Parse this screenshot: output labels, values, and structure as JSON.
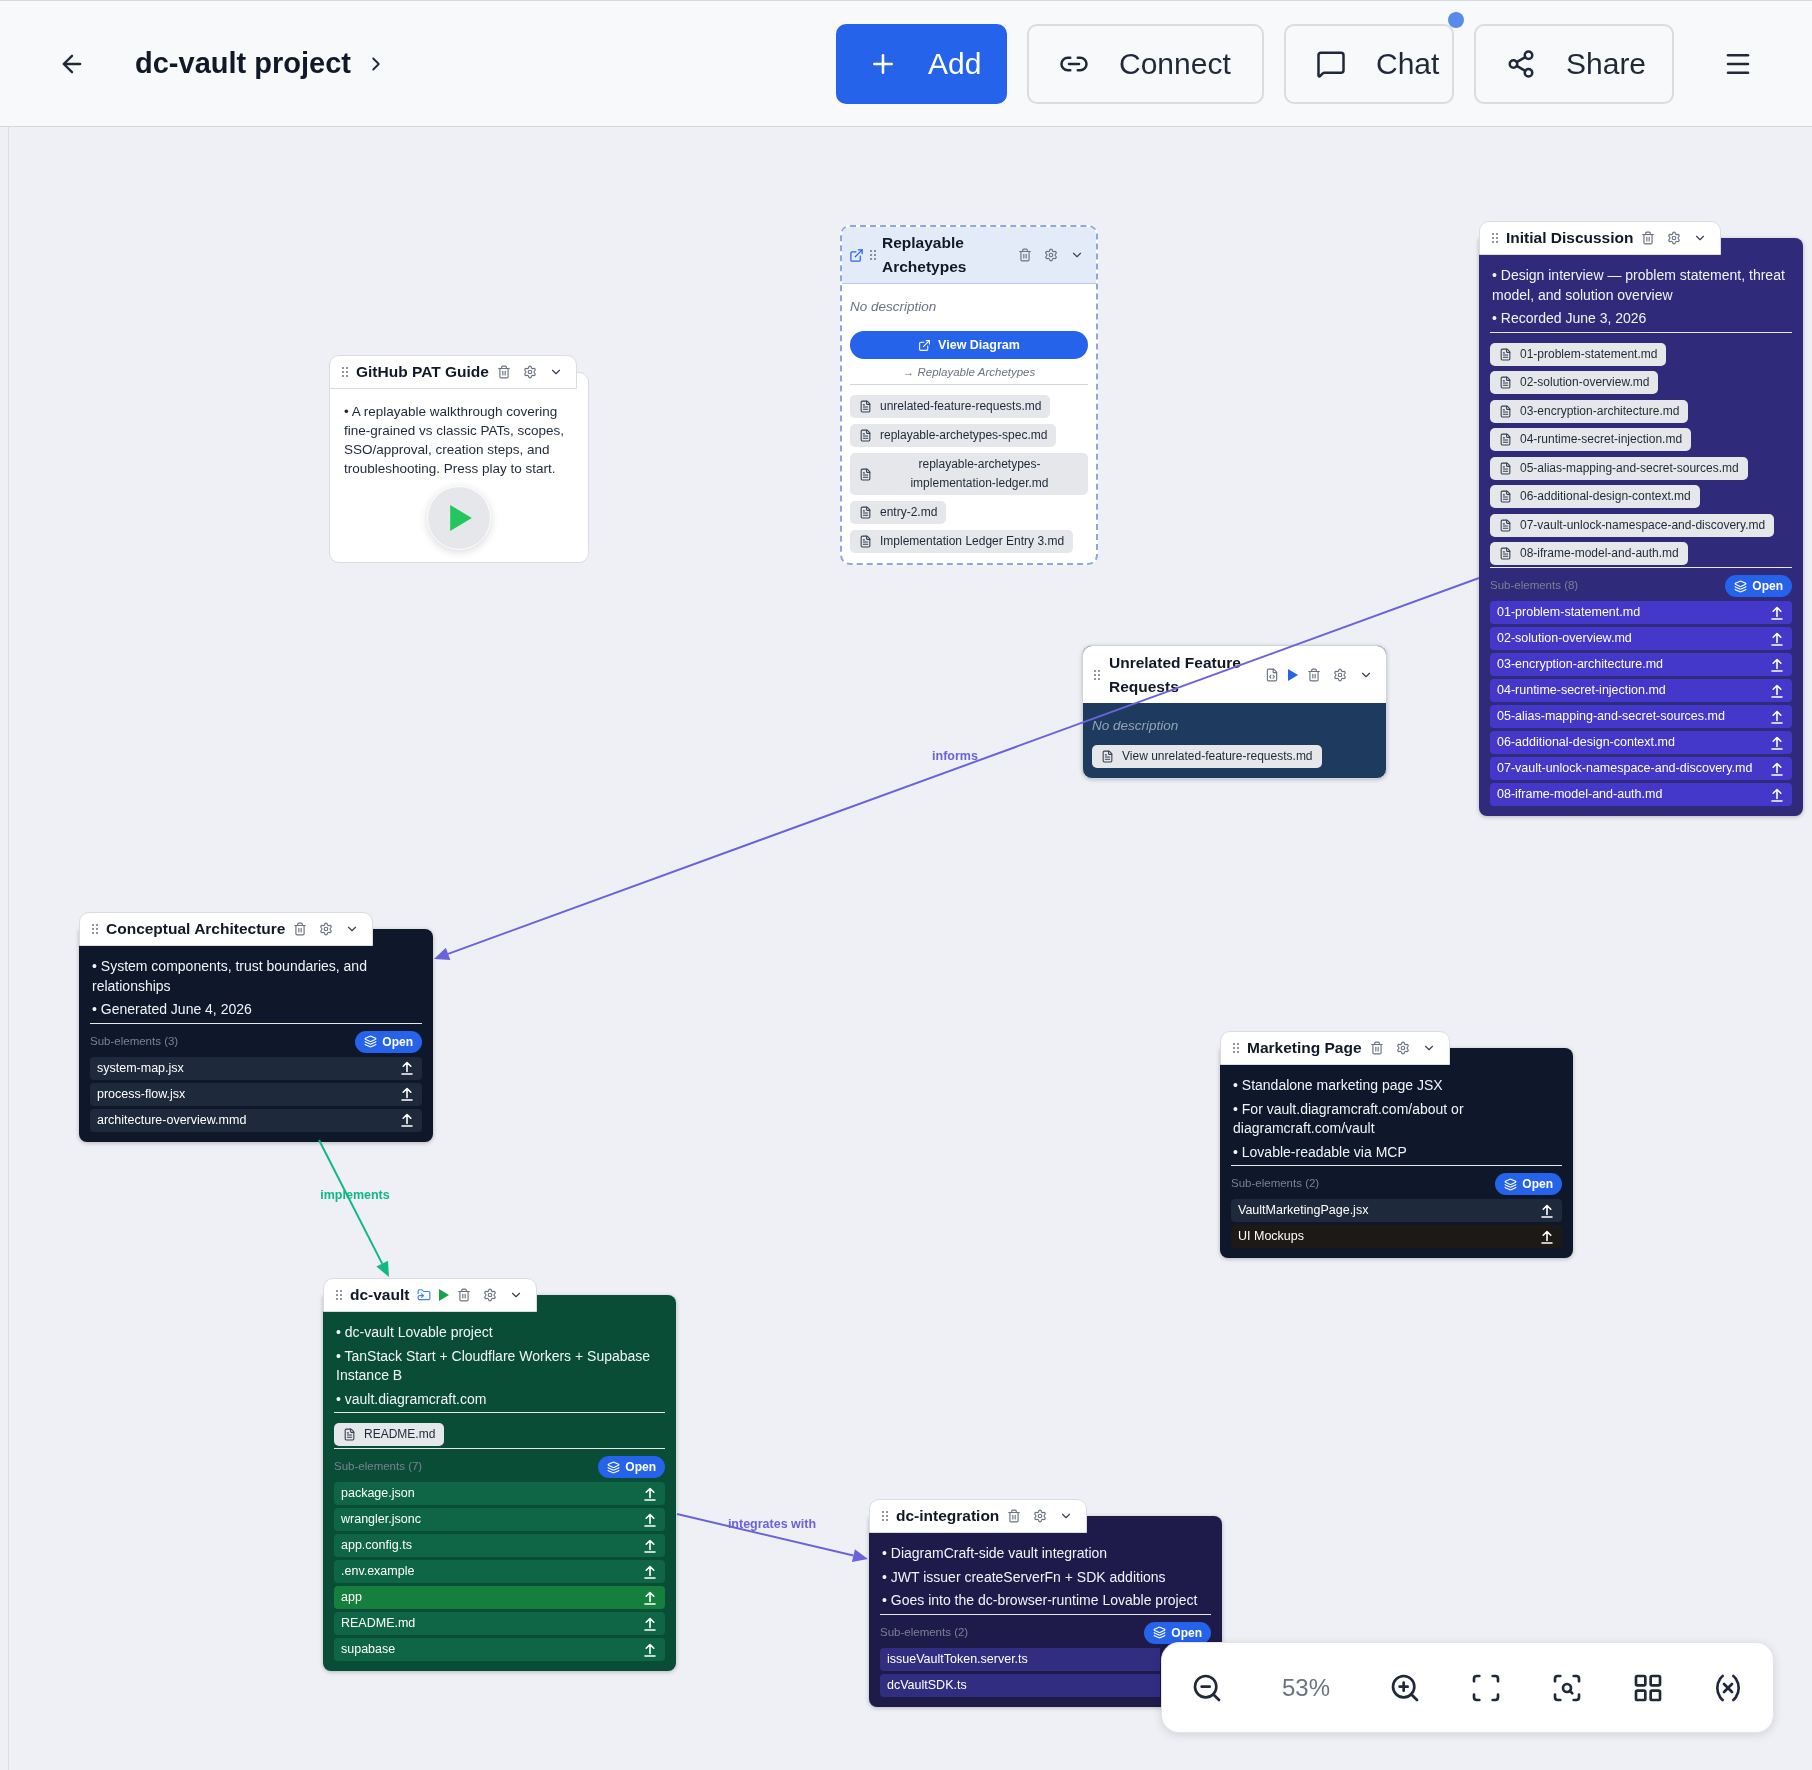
{
  "header": {
    "title": "dc-vault project",
    "buttons": [
      {
        "label": "Add",
        "kind": "primary",
        "notification": false
      },
      {
        "label": "Connect",
        "kind": "secondary",
        "notification": false
      },
      {
        "label": "Chat",
        "kind": "secondary",
        "notification": true
      },
      {
        "label": "Share",
        "kind": "secondary",
        "notification": false
      }
    ]
  },
  "canvas": {
    "nodes": [
      {
        "kind": "diagram",
        "title": "Replayable Archetypes",
        "playable": false,
        "description": "No description",
        "button": "View Diagram",
        "target": "→ Replayable Archetypes",
        "files": [
          "unrelated-feature-requests.md",
          "replayable-archetypes-spec.md",
          "replayable-archetypes-implementation-ledger.md",
          "entry-2.md",
          "Implementation Ledger Entry 3.md"
        ]
      },
      {
        "kind": "group",
        "title": "Initial Discussion",
        "playable": false,
        "color": "#2f2a7a",
        "bullets": [
          "• Design interview — problem statement, threat model, and solution overview",
          "• Recorded June 3, 2026"
        ],
        "files": [
          "01-problem-statement.md",
          "02-solution-overview.md",
          "03-encryption-architecture.md",
          "04-runtime-secret-injection.md",
          "05-alias-mapping-and-secret-sources.md",
          "06-additional-design-context.md",
          "07-vault-unlock-namespace-and-discovery.md",
          "08-iframe-model-and-auth.md"
        ],
        "sub_elements": {
          "label": "Sub-elements (8)",
          "button": "Open",
          "items": [
            {
              "name": "01-problem-statement.md",
              "color": "#4338ca"
            },
            {
              "name": "02-solution-overview.md",
              "color": "#4338ca"
            },
            {
              "name": "03-encryption-architecture.md",
              "color": "#4338ca"
            },
            {
              "name": "04-runtime-secret-injection.md",
              "color": "#4338ca"
            },
            {
              "name": "05-alias-mapping-and-secret-sources.md",
              "color": "#4338ca"
            },
            {
              "name": "06-additional-design-context.md",
              "color": "#4338ca"
            },
            {
              "name": "07-vault-unlock-namespace-and-discovery.md",
              "color": "#4338ca"
            },
            {
              "name": "08-iframe-model-and-auth.md",
              "color": "#4338ca"
            }
          ]
        }
      },
      {
        "kind": "note",
        "title": "GitHub PAT Guide",
        "playable": true,
        "bullets": [
          "• A replayable walkthrough covering fine-grained vs classic PATs, scopes, SSO/approval, creation steps, and troubleshooting. Press play to start."
        ]
      },
      {
        "kind": "document",
        "title": "Unrelated Feature Requests",
        "playable": true,
        "color": "#1e3a5f",
        "description": "No description",
        "button": "View unrelated-feature-requests.md"
      },
      {
        "kind": "group",
        "title": "Conceptual Architecture",
        "playable": false,
        "color": "#0f172a",
        "bullets": [
          "• System components, trust boundaries, and relationships",
          "• Generated June 4, 2026"
        ],
        "sub_elements": {
          "label": "Sub-elements (3)",
          "button": "Open",
          "items": [
            {
              "name": "system-map.jsx",
              "color": "#1e293b"
            },
            {
              "name": "process-flow.jsx",
              "color": "#1e293b"
            },
            {
              "name": "architecture-overview.mmd",
              "color": "#1e293b"
            }
          ]
        }
      },
      {
        "kind": "group",
        "title": "Marketing Page",
        "playable": false,
        "color": "#0f172a",
        "bullets": [
          "• Standalone marketing page JSX",
          "• For vault.diagramcraft.com/about or diagramcraft.com/vault",
          "• Lovable-readable via MCP"
        ],
        "sub_elements": {
          "label": "Sub-elements (2)",
          "button": "Open",
          "items": [
            {
              "name": "VaultMarketingPage.jsx",
              "color": "#1e293b"
            },
            {
              "name": "UI Mockups",
              "color": "#1c1917"
            }
          ]
        }
      },
      {
        "kind": "project",
        "title": "dc-vault",
        "playable": true,
        "color": "#0a4d36",
        "bullets": [
          "• dc-vault Lovable project",
          "• TanStack Start + Cloudflare Workers + Supabase Instance B",
          "• vault.diagramcraft.com"
        ],
        "files": [
          "README.md"
        ],
        "sub_elements": {
          "label": "Sub-elements (7)",
          "button": "Open",
          "items": [
            {
              "name": "package.json",
              "color": "#0e6646"
            },
            {
              "name": "wrangler.jsonc",
              "color": "#0e6646"
            },
            {
              "name": "app.config.ts",
              "color": "#0e6646"
            },
            {
              "name": ".env.example",
              "color": "#0e6646"
            },
            {
              "name": "app",
              "color": "#15803d"
            },
            {
              "name": "README.md",
              "color": "#0e6646"
            },
            {
              "name": "supabase",
              "color": "#0e6646"
            }
          ]
        }
      },
      {
        "kind": "group",
        "title": "dc-integration",
        "playable": false,
        "color": "#1e1b4b",
        "bullets": [
          "• DiagramCraft-side vault integration",
          "• JWT issuer createServerFn + SDK additions",
          "• Goes into the dc-browser-runtime Lovable project"
        ],
        "sub_elements": {
          "label": "Sub-elements (2)",
          "button": "Open",
          "items": [
            {
              "name": "issueVaultToken.server.ts",
              "color": "#312e81"
            },
            {
              "name": "dcVaultSDK.ts",
              "color": "#312e81"
            }
          ]
        }
      }
    ],
    "edges": [
      {
        "label": "informs",
        "color": "#6b63d9"
      },
      {
        "label": "implements",
        "color": "#10b981"
      },
      {
        "label": "integrates with",
        "color": "#6b63d9"
      }
    ]
  },
  "zoom_controls": {
    "level_text": "53%"
  }
}
